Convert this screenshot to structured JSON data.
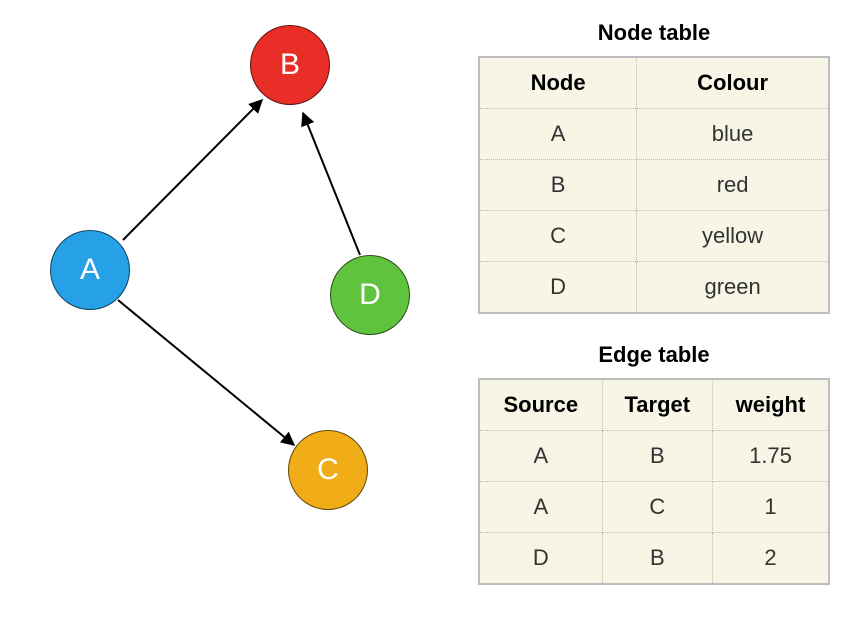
{
  "graph": {
    "nodes": [
      {
        "id": "A",
        "label": "A",
        "color": "#26a0e7",
        "colour_name": "blue"
      },
      {
        "id": "B",
        "label": "B",
        "color": "#e92d27",
        "colour_name": "red"
      },
      {
        "id": "C",
        "label": "C",
        "color": "#f1ad18",
        "colour_name": "yellow"
      },
      {
        "id": "D",
        "label": "D",
        "color": "#60c33d",
        "colour_name": "green"
      }
    ],
    "edges": [
      {
        "source": "A",
        "target": "B",
        "weight": "1.75"
      },
      {
        "source": "A",
        "target": "C",
        "weight": "1"
      },
      {
        "source": "D",
        "target": "B",
        "weight": "2"
      }
    ]
  },
  "node_table": {
    "title": "Node table",
    "headers": {
      "node": "Node",
      "colour": "Colour"
    }
  },
  "edge_table": {
    "title": "Edge table",
    "headers": {
      "source": "Source",
      "target": "Target",
      "weight": "weight"
    }
  }
}
